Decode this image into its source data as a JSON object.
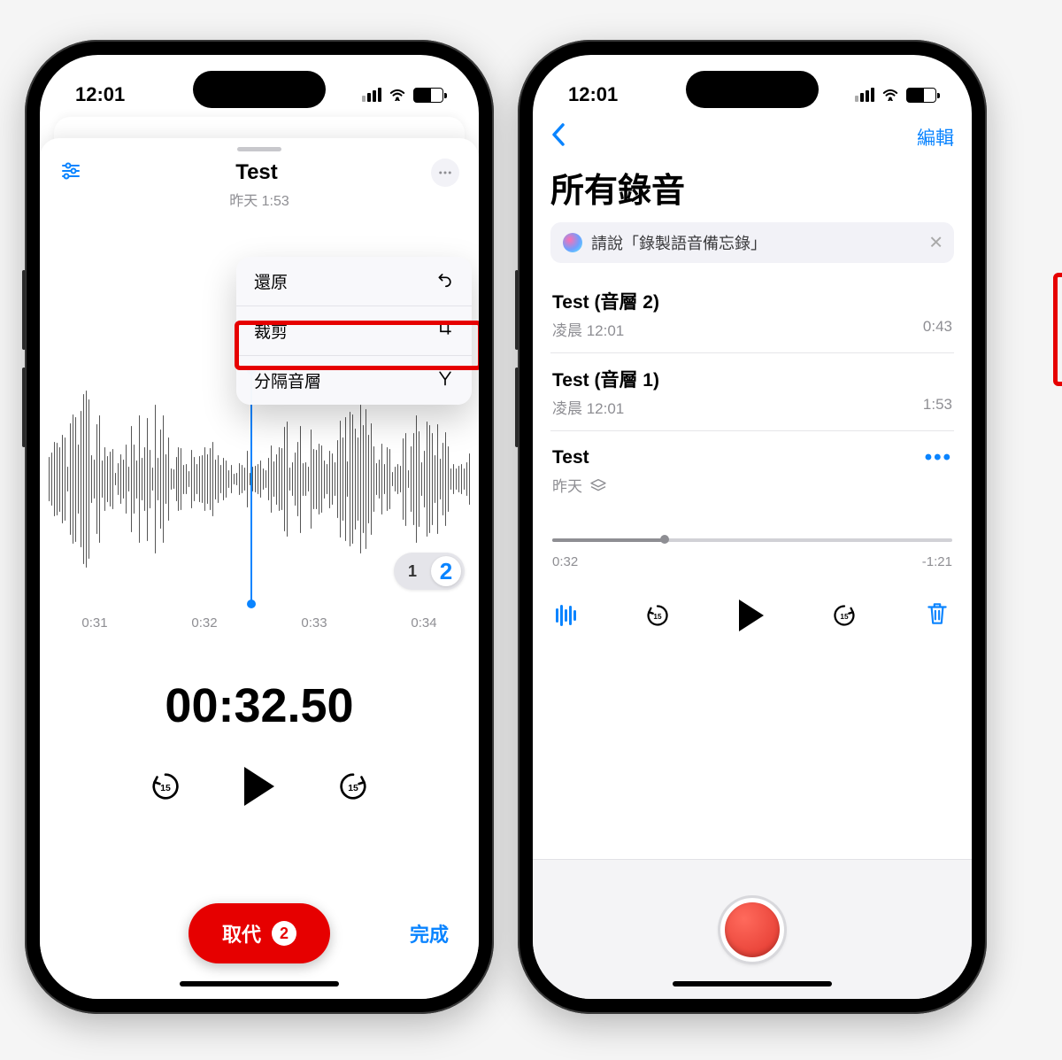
{
  "status": {
    "time": "12:01"
  },
  "left": {
    "title": "Test",
    "subtitle": "昨天  1:53",
    "menu": {
      "undo": "還原",
      "trim": "裁剪",
      "split": "分隔音層"
    },
    "layers": {
      "one": "1",
      "two": "2"
    },
    "ticks": [
      "0:31",
      "0:32",
      "0:33",
      "0:34"
    ],
    "bigTime": "00:32.50",
    "replace": "取代",
    "replaceBadge": "2",
    "done": "完成"
  },
  "right": {
    "edit": "編輯",
    "pageTitle": "所有錄音",
    "siriTip": "請說「錄製語音備忘錄」",
    "items": [
      {
        "title": "Test (音層 2)",
        "sub": "凌晨 12:01",
        "dur": "0:43"
      },
      {
        "title": "Test (音層 1)",
        "sub": "凌晨 12:01",
        "dur": "1:53"
      }
    ],
    "selected": {
      "title": "Test",
      "sub": "昨天",
      "elapsed": "0:32",
      "remaining": "-1:21"
    }
  }
}
